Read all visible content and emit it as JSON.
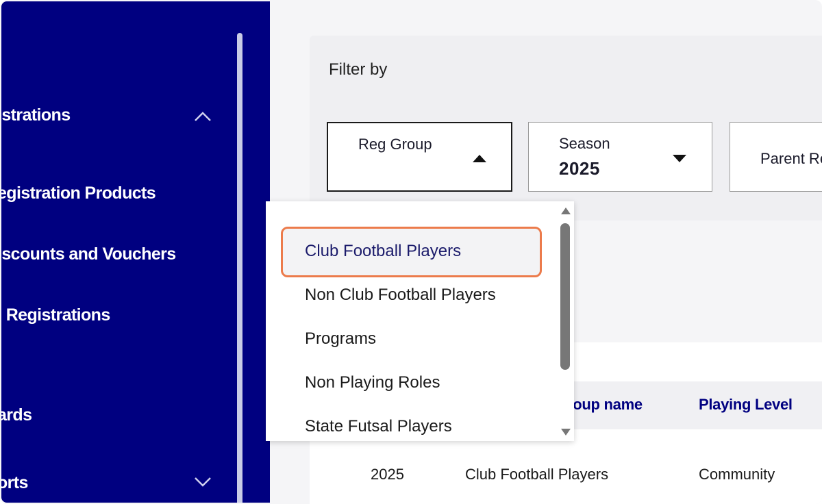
{
  "sidebar": {
    "items": [
      {
        "label": "Registrations",
        "visible_text": "istrations"
      },
      {
        "label": "Registration Products",
        "visible_text": "egistration Products"
      },
      {
        "label": "Discounts and Vouchers",
        "visible_text": "iscounts and Vouchers"
      },
      {
        "label": "All Registrations",
        "visible_text": "l Registrations"
      },
      {
        "label": "Cards",
        "visible_text": "ards"
      },
      {
        "label": "Reports",
        "visible_text": "orts"
      }
    ]
  },
  "filter": {
    "title": "Filter by",
    "dropdowns": [
      {
        "label": "Reg Group",
        "value": "",
        "open": true
      },
      {
        "label": "Season",
        "value": "2025",
        "open": false
      },
      {
        "label": "Parent Re",
        "value": "",
        "open": false
      }
    ]
  },
  "menu": {
    "options": [
      {
        "label": "Club Football Players",
        "selected": true
      },
      {
        "label": "Non Club Football Players",
        "selected": false
      },
      {
        "label": "Programs",
        "selected": false
      },
      {
        "label": "Non Playing Roles",
        "selected": false
      },
      {
        "label": "State Futsal Players",
        "selected": false
      }
    ]
  },
  "table": {
    "headers": [
      "roup name",
      "Playing Level"
    ],
    "rows": [
      {
        "season": "2025",
        "group_name": "Club Football Players",
        "playing_level": "Community"
      }
    ]
  },
  "colors": {
    "sidebar_bg": "#000080",
    "header_text": "#000080",
    "highlight_border": "#ec7b4b"
  }
}
